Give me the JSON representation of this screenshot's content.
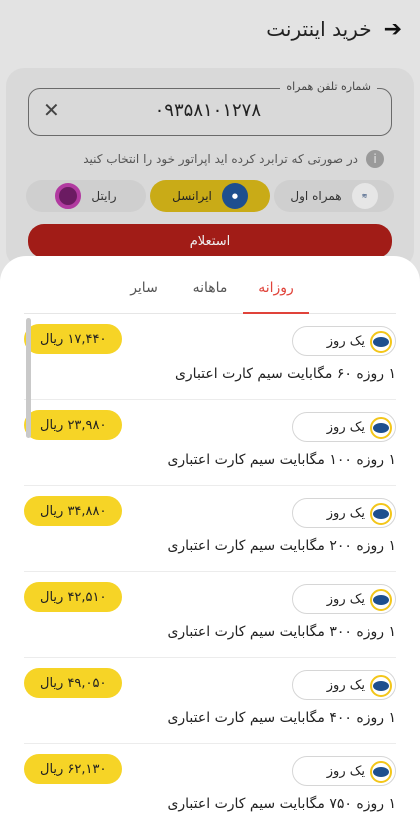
{
  "header": {
    "title": "خرید اینترنت",
    "back_icon": "arrow-right-icon"
  },
  "form": {
    "phone_label": "شماره تلفن همراه",
    "phone_value": "۰۹۳۵۸۱۰۱۲۷۸",
    "hint": "در صورتی که ترابرد کرده اید اپراتور خود را انتخاب کنید",
    "operators": [
      {
        "label": "همراه اول",
        "logo": "hamrahe-aval-logo",
        "selected": false
      },
      {
        "label": "ایرانسل",
        "logo": "irancell-logo",
        "selected": true
      },
      {
        "label": "رایتل",
        "logo": "rightel-logo",
        "selected": false
      }
    ],
    "inquiry_label": "استعلام"
  },
  "sheet": {
    "tabs": [
      {
        "label": "روزانه",
        "active": true
      },
      {
        "label": "ماهانه",
        "active": false
      },
      {
        "label": "سایر",
        "active": false
      }
    ],
    "items": [
      {
        "duration": "یک روز",
        "price": "۱۷,۴۴۰ ریال",
        "desc": "۱ روزه ۶۰ مگابایت سیم کارت اعتباری"
      },
      {
        "duration": "یک روز",
        "price": "۲۳,۹۸۰ ریال",
        "desc": "۱ روزه ۱۰۰ مگابایت سیم کارت اعتباری"
      },
      {
        "duration": "یک روز",
        "price": "۳۴,۸۸۰ ریال",
        "desc": "۱ روزه ۲۰۰ مگابایت سیم کارت اعتباری"
      },
      {
        "duration": "یک روز",
        "price": "۴۲,۵۱۰ ریال",
        "desc": "۱ روزه ۳۰۰ مگابایت سیم کارت اعتباری"
      },
      {
        "duration": "یک روز",
        "price": "۴۹,۰۵۰ ریال",
        "desc": "۱ روزه ۴۰۰ مگابایت سیم کارت اعتباری"
      },
      {
        "duration": "یک روز",
        "price": "۶۲,۱۳۰ ریال",
        "desc": "۱ روزه ۷۵۰ مگابایت سیم کارت اعتباری"
      }
    ]
  },
  "colors": {
    "accent": "#e0433a",
    "price_pill": "#f6d426",
    "selected_operator": "#f2c400"
  }
}
